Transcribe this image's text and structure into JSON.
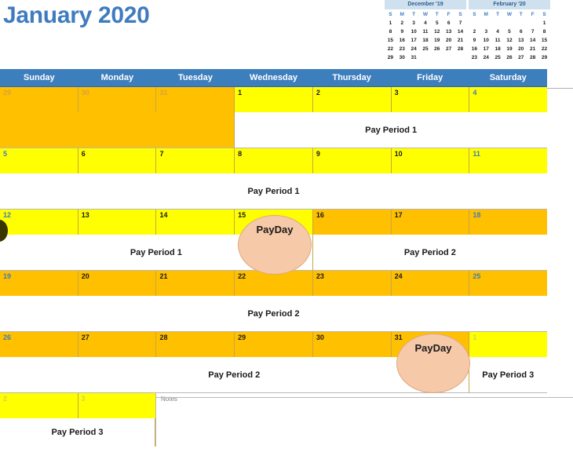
{
  "title": "January 2020",
  "mini_calendars": [
    {
      "name": "prev-month",
      "title": "December '19",
      "dow": [
        "S",
        "M",
        "T",
        "W",
        "T",
        "F",
        "S"
      ],
      "weeks": [
        [
          "1",
          "2",
          "3",
          "4",
          "5",
          "6",
          "7"
        ],
        [
          "8",
          "9",
          "10",
          "11",
          "12",
          "13",
          "14"
        ],
        [
          "15",
          "16",
          "17",
          "18",
          "19",
          "20",
          "21"
        ],
        [
          "22",
          "23",
          "24",
          "25",
          "26",
          "27",
          "28"
        ],
        [
          "29",
          "30",
          "31",
          "",
          "",
          "",
          ""
        ]
      ]
    },
    {
      "name": "next-month",
      "title": "February '20",
      "dow": [
        "S",
        "M",
        "T",
        "W",
        "T",
        "F",
        "S"
      ],
      "weeks": [
        [
          "",
          "",
          "",
          "",
          "",
          "",
          "1"
        ],
        [
          "2",
          "3",
          "4",
          "5",
          "6",
          "7",
          "8"
        ],
        [
          "9",
          "10",
          "11",
          "12",
          "13",
          "14",
          "15"
        ],
        [
          "16",
          "17",
          "18",
          "19",
          "20",
          "21",
          "22"
        ],
        [
          "23",
          "24",
          "25",
          "26",
          "27",
          "28",
          "29"
        ]
      ]
    }
  ],
  "weekday_headers": [
    "Sunday",
    "Monday",
    "Tuesday",
    "Wednesday",
    "Thursday",
    "Friday",
    "Saturday"
  ],
  "weeks": [
    {
      "days": [
        {
          "num": "29",
          "fill": "orange",
          "kind": "other-month"
        },
        {
          "num": "30",
          "fill": "orange",
          "kind": "other-month"
        },
        {
          "num": "31",
          "fill": "orange",
          "kind": "other-month"
        },
        {
          "num": "1",
          "fill": "yellow",
          "kind": "weekday"
        },
        {
          "num": "2",
          "fill": "yellow",
          "kind": "weekday"
        },
        {
          "num": "3",
          "fill": "yellow",
          "kind": "weekday"
        },
        {
          "num": "4",
          "fill": "yellow",
          "kind": "weekend"
        }
      ],
      "bands": [
        {
          "label": "",
          "span": 3,
          "style": "orange-fill"
        },
        {
          "label": "Pay Period 1",
          "span": 4,
          "style": "white"
        }
      ]
    },
    {
      "days": [
        {
          "num": "5",
          "fill": "yellow",
          "kind": "weekend"
        },
        {
          "num": "6",
          "fill": "yellow",
          "kind": "weekday"
        },
        {
          "num": "7",
          "fill": "yellow",
          "kind": "weekday"
        },
        {
          "num": "8",
          "fill": "yellow",
          "kind": "weekday"
        },
        {
          "num": "9",
          "fill": "yellow",
          "kind": "weekday"
        },
        {
          "num": "10",
          "fill": "yellow",
          "kind": "weekday"
        },
        {
          "num": "11",
          "fill": "yellow",
          "kind": "weekend"
        }
      ],
      "bands": [
        {
          "label": "Pay Period 1",
          "span": 7,
          "style": "white"
        }
      ]
    },
    {
      "days": [
        {
          "num": "12",
          "fill": "yellow",
          "kind": "weekend"
        },
        {
          "num": "13",
          "fill": "yellow",
          "kind": "weekday"
        },
        {
          "num": "14",
          "fill": "yellow",
          "kind": "weekday"
        },
        {
          "num": "15",
          "fill": "yellow",
          "kind": "weekday"
        },
        {
          "num": "16",
          "fill": "orange",
          "kind": "weekday"
        },
        {
          "num": "17",
          "fill": "orange",
          "kind": "weekday"
        },
        {
          "num": "18",
          "fill": "orange",
          "kind": "weekend"
        }
      ],
      "bands": [
        {
          "label": "Pay Period 1",
          "span": 4,
          "style": "white"
        },
        {
          "label": "Pay Period 2",
          "span": 3,
          "style": "white"
        }
      ]
    },
    {
      "days": [
        {
          "num": "19",
          "fill": "orange",
          "kind": "weekend"
        },
        {
          "num": "20",
          "fill": "orange",
          "kind": "weekday"
        },
        {
          "num": "21",
          "fill": "orange",
          "kind": "weekday"
        },
        {
          "num": "22",
          "fill": "orange",
          "kind": "weekday"
        },
        {
          "num": "23",
          "fill": "orange",
          "kind": "weekday"
        },
        {
          "num": "24",
          "fill": "orange",
          "kind": "weekday"
        },
        {
          "num": "25",
          "fill": "orange",
          "kind": "weekend"
        }
      ],
      "bands": [
        {
          "label": "Pay Period 2",
          "span": 7,
          "style": "white"
        }
      ]
    },
    {
      "days": [
        {
          "num": "26",
          "fill": "orange",
          "kind": "weekend"
        },
        {
          "num": "27",
          "fill": "orange",
          "kind": "weekday"
        },
        {
          "num": "28",
          "fill": "orange",
          "kind": "weekday"
        },
        {
          "num": "29",
          "fill": "orange",
          "kind": "weekday"
        },
        {
          "num": "30",
          "fill": "orange",
          "kind": "weekday"
        },
        {
          "num": "31",
          "fill": "orange",
          "kind": "weekday"
        },
        {
          "num": "1",
          "fill": "yellow",
          "kind": "other-month-yellow"
        }
      ],
      "bands": [
        {
          "label": "Pay Period 2",
          "span": 6,
          "style": "white"
        },
        {
          "label": "Pay Period 3",
          "span": 1,
          "style": "white"
        }
      ]
    }
  ],
  "spill_row": {
    "days": [
      {
        "num": "2",
        "fill": "yellow",
        "kind": "other-month-yellow"
      },
      {
        "num": "3",
        "fill": "yellow",
        "kind": "other-month-yellow"
      }
    ],
    "band_label": "Pay Period 3"
  },
  "paydays": [
    {
      "label": "PayDay",
      "day": "15"
    },
    {
      "label": "PayDay",
      "day": "31"
    }
  ],
  "notes": {
    "label": "Notes"
  },
  "colors": {
    "header_blue": "#3d7ebd",
    "title_blue": "#3f7cbf",
    "pay_period_1_fill": "#ffff00",
    "pay_period_2_fill": "#ffc000",
    "payday_oval": "#f6c9a8",
    "mini_cal_header": "#cfe0ef"
  }
}
